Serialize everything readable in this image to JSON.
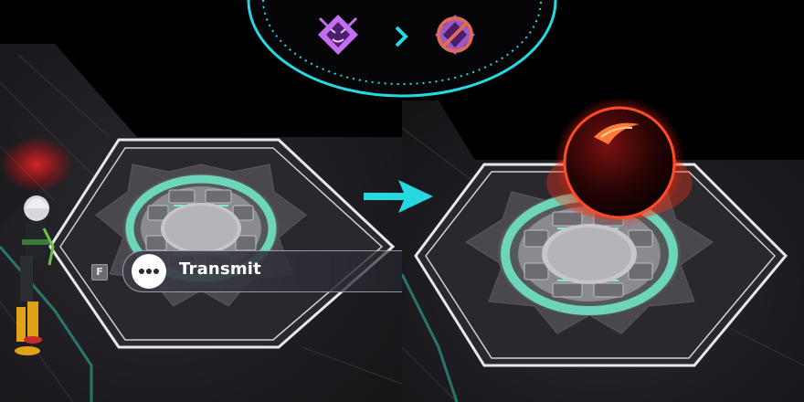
{
  "prompt": {
    "key": "F",
    "label": "Transmit",
    "icon": "chat-bubble-icon"
  },
  "hud": {
    "from_icon": "demon-crest-icon",
    "to_icon": "demon-crest-disabled-icon",
    "separator_icon": "chevron-right-icon",
    "accent_color": "#26d9e0",
    "from_color": "#c36df0",
    "to_color": "#e06a5a"
  },
  "transition_arrow": "arrow-right-icon"
}
